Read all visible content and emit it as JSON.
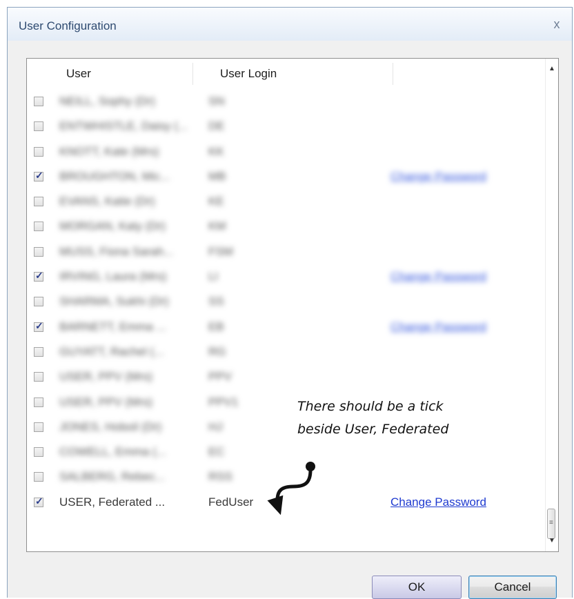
{
  "window": {
    "title": "User Configuration",
    "close_glyph": "x"
  },
  "list": {
    "columns": [
      "User",
      "User Login"
    ],
    "rows": [
      {
        "checked": false,
        "user": "NEILL, Sophy (Dr)",
        "login": "SN",
        "change_password": ""
      },
      {
        "checked": false,
        "user": "ENTWHISTLE, Daisy (...",
        "login": "DE",
        "change_password": ""
      },
      {
        "checked": false,
        "user": "KNOTT, Kate (Mrs)",
        "login": "KK",
        "change_password": ""
      },
      {
        "checked": true,
        "user": "BROUGHTON, Mic...",
        "login": "MB",
        "change_password": "Change Password"
      },
      {
        "checked": false,
        "user": "EVANS, Katie (Dr)",
        "login": "KE",
        "change_password": ""
      },
      {
        "checked": false,
        "user": "MORGAN, Katy (Dr)",
        "login": "KM",
        "change_password": ""
      },
      {
        "checked": false,
        "user": "MUSS, Fiona Sarah...",
        "login": "FSM",
        "change_password": ""
      },
      {
        "checked": true,
        "user": "IRVING, Laura (Mrs)",
        "login": "LI",
        "change_password": "Change Password"
      },
      {
        "checked": false,
        "user": "SHARMA, Sukhi (Dr)",
        "login": "SS",
        "change_password": ""
      },
      {
        "checked": true,
        "user": "BARNETT, Emma ...",
        "login": "EB",
        "change_password": "Change Password"
      },
      {
        "checked": false,
        "user": "GUYATT, Rachel (...",
        "login": "RG",
        "change_password": ""
      },
      {
        "checked": false,
        "user": "USER, PPV (Mrs)",
        "login": "PPV",
        "change_password": ""
      },
      {
        "checked": false,
        "user": "USER, PPV (Mrs)",
        "login": "PPV1",
        "change_password": ""
      },
      {
        "checked": false,
        "user": "JONES, Hoboil (Dr)",
        "login": "HJ",
        "change_password": ""
      },
      {
        "checked": false,
        "user": "COWELL, Emma (...",
        "login": "EC",
        "change_password": ""
      },
      {
        "checked": false,
        "user": "SALBERG, Rebec...",
        "login": "RSS",
        "change_password": ""
      },
      {
        "checked": true,
        "user": "USER, Federated ...",
        "login": "FedUser",
        "change_password": "Change Password"
      }
    ]
  },
  "annotation": {
    "line1": "There should be a tick",
    "line2": "beside User, Federated"
  },
  "buttons": {
    "ok": "OK",
    "cancel": "Cancel"
  },
  "colors": {
    "link": "#1e3ad0",
    "title_text": "#2e4a70"
  }
}
